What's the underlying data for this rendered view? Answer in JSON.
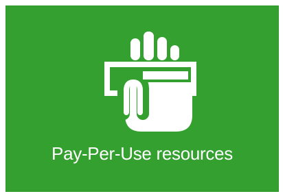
{
  "tile": {
    "label": "Pay-Per-Use resources",
    "icon": "hand-card-icon",
    "background_color": "#33a02f",
    "foreground_color": "#ffffff"
  }
}
